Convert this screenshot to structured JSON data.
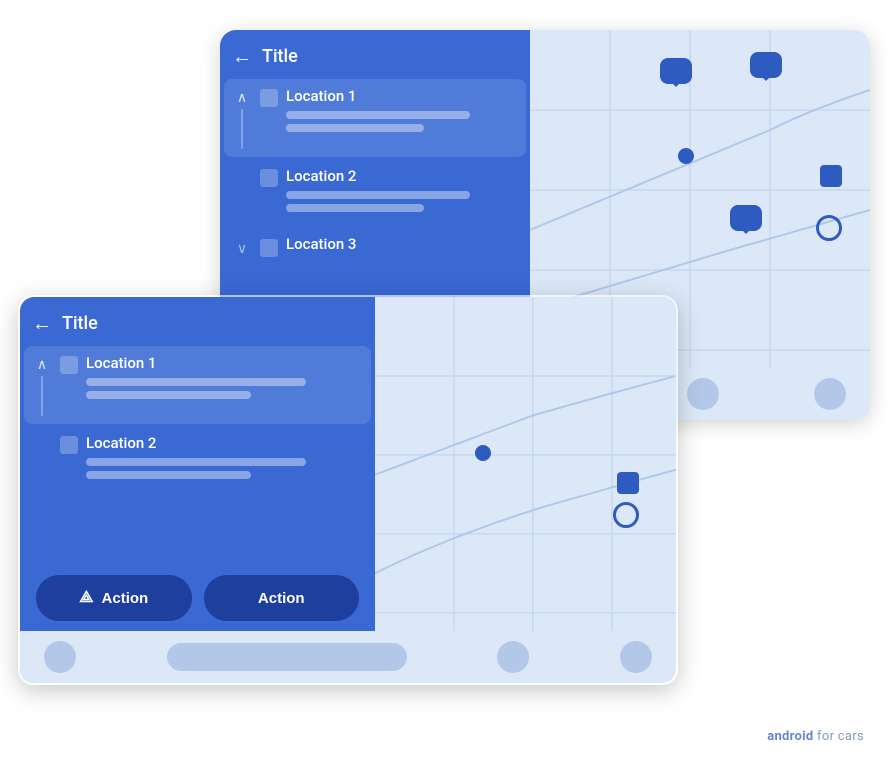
{
  "back_card": {
    "title": "Title",
    "back_label": "←",
    "locations": [
      {
        "name": "Location 1",
        "bars": [
          "long",
          "medium"
        ]
      },
      {
        "name": "Location 2",
        "bars": [
          "long",
          "medium"
        ]
      },
      {
        "name": "Location 3",
        "bars": []
      }
    ]
  },
  "front_card": {
    "title": "Title",
    "back_label": "←",
    "locations": [
      {
        "name": "Location 1",
        "bars": [
          "long",
          "medium"
        ]
      },
      {
        "name": "Location 2",
        "bars": [
          "long",
          "medium"
        ]
      }
    ],
    "action1": "Action",
    "action2": "Action"
  },
  "bottom_bar": {
    "pill_width_back": "220px",
    "pill_width_front": "240px"
  },
  "brand": {
    "strong": "android",
    "rest": " for cars"
  }
}
